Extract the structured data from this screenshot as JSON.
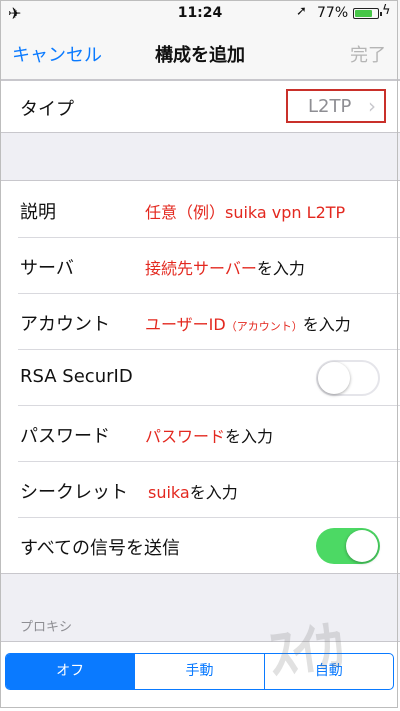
{
  "status": {
    "airplane_icon": "airplane-icon",
    "time": "11:24",
    "location_icon": "location-arrow-icon",
    "battery": "77%",
    "battery_level": 0.77,
    "charging_icon": "bolt-icon"
  },
  "nav": {
    "cancel": "キャンセル",
    "title": "構成を追加",
    "done": "完了"
  },
  "type_row": {
    "label": "タイプ",
    "value": "L2TP",
    "chevron": "›"
  },
  "rows": {
    "description": {
      "label": "説明",
      "hint": "任意（例）suika vpn L2TP"
    },
    "server": {
      "label": "サーバ",
      "hint_red": "接続先サーバー",
      "hint_rest": "を入力"
    },
    "account": {
      "label": "アカウント",
      "hint_red": "ユーザーID",
      "hint_small": "（アカウント）",
      "hint_rest": "を入力"
    },
    "rsa": {
      "label": "RSA SecurID",
      "on": false
    },
    "password": {
      "label": "パスワード",
      "hint_red": "パスワード",
      "hint_rest": "を入力"
    },
    "secret": {
      "label": "シークレット",
      "hint_red": "suika",
      "hint_rest": "を入力"
    },
    "send_all": {
      "label": "すべての信号を送信",
      "on": true
    }
  },
  "proxy": {
    "header": "プロキシ",
    "options": [
      "オフ",
      "手動",
      "自動"
    ],
    "selected": "オフ"
  },
  "colors": {
    "accent": "#0a7aff",
    "annotation": "#e3281f",
    "switch_on": "#4cd964"
  }
}
